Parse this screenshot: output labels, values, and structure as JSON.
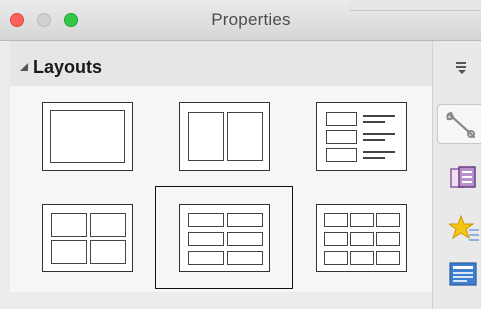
{
  "window": {
    "title": "Properties"
  },
  "section": {
    "title": "Layouts"
  },
  "layouts": [
    {
      "name": "blank-layout"
    },
    {
      "name": "two-columns-layout"
    },
    {
      "name": "title-content-list-layout"
    },
    {
      "name": "four-boxes-layout"
    },
    {
      "name": "six-boxes-layout",
      "selected": true
    },
    {
      "name": "nine-boxes-layout"
    }
  ],
  "sidebar": {
    "items": [
      {
        "icon": "menu-icon"
      },
      {
        "icon": "wrench-icon"
      },
      {
        "icon": "slide-transition-icon"
      },
      {
        "icon": "star-animation-icon"
      },
      {
        "icon": "master-slides-icon"
      }
    ]
  },
  "colors": {
    "close": "#fc605c",
    "minimize": "#d0d0d0",
    "maximize": "#34c84a",
    "selected_border": "#111111"
  }
}
